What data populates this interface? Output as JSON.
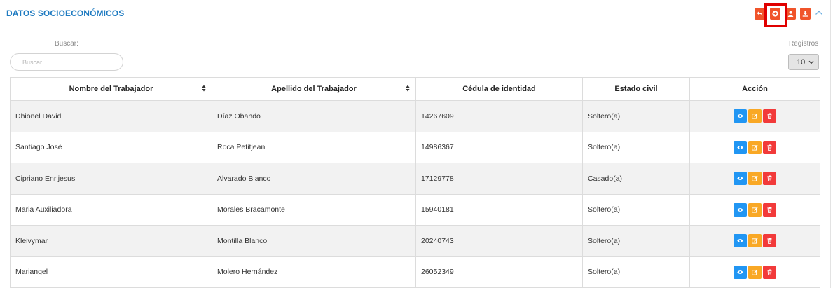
{
  "section": {
    "title": "DATOS SOCIOECONÓMICOS"
  },
  "toolbar": {
    "buttons": [
      {
        "icon": "reply-icon",
        "color": "#f0542a"
      },
      {
        "icon": "plus-circle-icon",
        "color": "#f0542a"
      },
      {
        "icon": "user-icon",
        "color": "#f0542a"
      },
      {
        "icon": "download-icon",
        "color": "#f0542a"
      }
    ],
    "collapse_icon": "chevron-up-icon",
    "highlight_color": "#e00000"
  },
  "search": {
    "label": "Buscar:",
    "placeholder": "Buscar...",
    "value": ""
  },
  "records": {
    "label": "Registros",
    "selected": "10"
  },
  "table": {
    "headers": [
      "Nombre del Trabajador",
      "Apellido del Trabajador",
      "Cédula de identidad",
      "Estado civil",
      "Acción"
    ],
    "rows": [
      {
        "nombre": "Dhionel David",
        "apellido": "Díaz Obando",
        "cedula": "14267609",
        "estado": "Soltero(a)"
      },
      {
        "nombre": "Santiago José",
        "apellido": "Roca Petitjean",
        "cedula": "14986367",
        "estado": "Soltero(a)"
      },
      {
        "nombre": "Cipriano Enrijesus",
        "apellido": "Alvarado Blanco",
        "cedula": "17129778",
        "estado": "Casado(a)"
      },
      {
        "nombre": "Maria Auxiliadora",
        "apellido": "Morales Bracamonte",
        "cedula": "15940181",
        "estado": "Soltero(a)"
      },
      {
        "nombre": "Kleivymar",
        "apellido": "Montilla Blanco",
        "cedula": "20240743",
        "estado": "Soltero(a)"
      },
      {
        "nombre": "Mariangel",
        "apellido": "Molero Hernández",
        "cedula": "26052349",
        "estado": "Soltero(a)"
      }
    ],
    "action_icons": [
      "eye-icon",
      "edit-icon",
      "trash-icon"
    ],
    "action_colors": {
      "view": "#2196f3",
      "edit": "#f9a825",
      "delete": "#f23a3a"
    }
  }
}
